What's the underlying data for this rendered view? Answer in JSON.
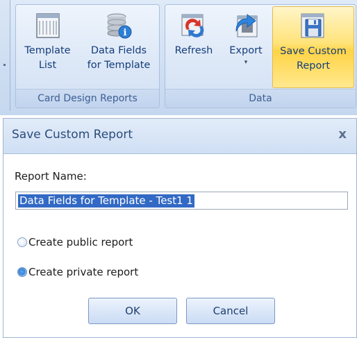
{
  "ribbon": {
    "groups": [
      {
        "label": "Card Design Reports",
        "buttons": [
          {
            "line1": "Template",
            "line2": "List",
            "icon": "template-list-icon"
          },
          {
            "line1": "Data Fields",
            "line2": "for Template",
            "icon": "database-info-icon"
          }
        ]
      },
      {
        "label": "Data",
        "buttons": [
          {
            "line1": "Refresh",
            "line2": "",
            "icon": "refresh-icon"
          },
          {
            "line1": "Export",
            "line2": "▾",
            "icon": "export-icon"
          },
          {
            "line1": "Save Custom",
            "line2": "Report",
            "icon": "save-icon"
          }
        ]
      }
    ]
  },
  "dialog": {
    "title": "Save Custom Report",
    "close_glyph": "x",
    "report_name_label": "Report Name:",
    "report_name_value": "Data Fields for Template - Test1 1",
    "options": [
      {
        "label": "Create public report",
        "checked": false
      },
      {
        "label": "Create private report",
        "checked": true
      }
    ],
    "ok_label": "OK",
    "cancel_label": "Cancel"
  },
  "colors": {
    "ribbon_bg": "#cfdff3",
    "active_button": "#ffd447",
    "selection": "#3269c4",
    "title_text": "#2a4c7d"
  }
}
